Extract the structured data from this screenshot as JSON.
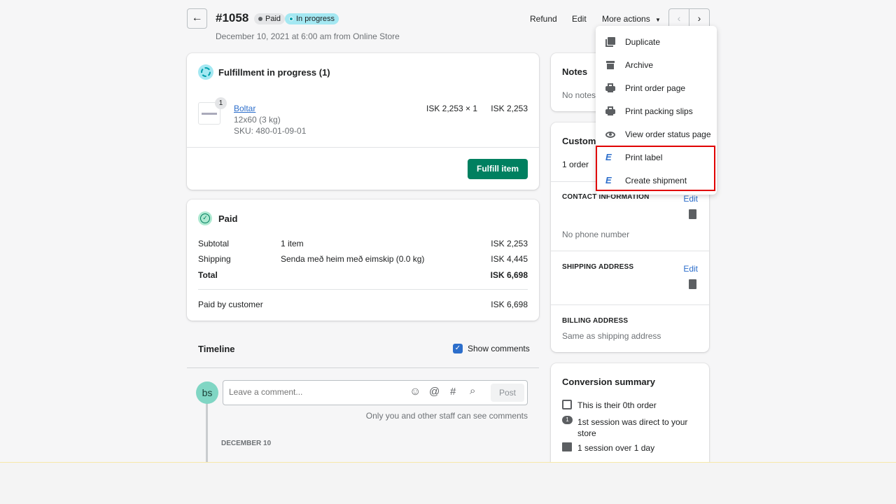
{
  "header": {
    "order_number": "#1058",
    "badges": [
      {
        "label": "Paid",
        "color": "#e4e5e7",
        "dot": "#5c5f62"
      },
      {
        "label": "In progress",
        "color": "#a4e8f2",
        "dot": "#00a0ac"
      }
    ],
    "subtitle": "December 10, 2021 at 6:00 am from Online Store",
    "refund": "Refund",
    "edit": "Edit",
    "more_actions": "More actions"
  },
  "dropdown": {
    "items": [
      {
        "label": "Duplicate",
        "icon": "duplicate-icon"
      },
      {
        "label": "Archive",
        "icon": "archive-icon"
      },
      {
        "label": "Print order page",
        "icon": "printer-icon"
      },
      {
        "label": "Print packing slips",
        "icon": "printer-icon"
      },
      {
        "label": "View order status page",
        "icon": "eye-icon"
      },
      {
        "label": "Print label",
        "icon": "eimskip-icon"
      },
      {
        "label": "Create shipment",
        "icon": "eimskip-icon"
      }
    ],
    "highlight_color": "#e00000"
  },
  "fulfillment": {
    "title": "Fulfillment in progress (1)",
    "item": {
      "name": "Boltar",
      "quantity_badge": "1",
      "variant": "12x60 (3 kg)",
      "sku": "SKU: 480-01-09-01",
      "unit": "ISK 2,253 × 1",
      "total": "ISK 2,253"
    },
    "button": "Fulfill item",
    "accent": "#008060"
  },
  "payment": {
    "title": "Paid",
    "rows": [
      {
        "label": "Subtotal",
        "desc": "1 item",
        "amount": "ISK 2,253"
      },
      {
        "label": "Shipping",
        "desc": "Senda með heim með eimskip (0.0 kg)",
        "amount": "ISK 4,445"
      },
      {
        "label": "Total",
        "desc": "",
        "amount": "ISK 6,698"
      }
    ],
    "paid_label": "Paid by customer",
    "paid_amount": "ISK 6,698"
  },
  "timeline": {
    "title": "Timeline",
    "show_comments": "Show comments",
    "show_comments_checked": true,
    "avatar": "bs",
    "placeholder": "Leave a comment...",
    "post": "Post",
    "hint": "Only you and other staff can see comments",
    "date": "DECEMBER 10"
  },
  "notes": {
    "title": "Notes",
    "text": "No notes"
  },
  "customer": {
    "title": "Customer",
    "orders": "1 order",
    "contact_title": "CONTACT INFORMATION",
    "contact_edit": "Edit",
    "phone": "No phone number",
    "shipping_title": "SHIPPING ADDRESS",
    "shipping_edit": "Edit",
    "billing_title": "BILLING ADDRESS",
    "billing_text": "Same as shipping address"
  },
  "conversion": {
    "title": "Conversion summary",
    "items": [
      "This is their 0th order",
      "1st session was direct to your store",
      "1 session over 1 day"
    ]
  }
}
